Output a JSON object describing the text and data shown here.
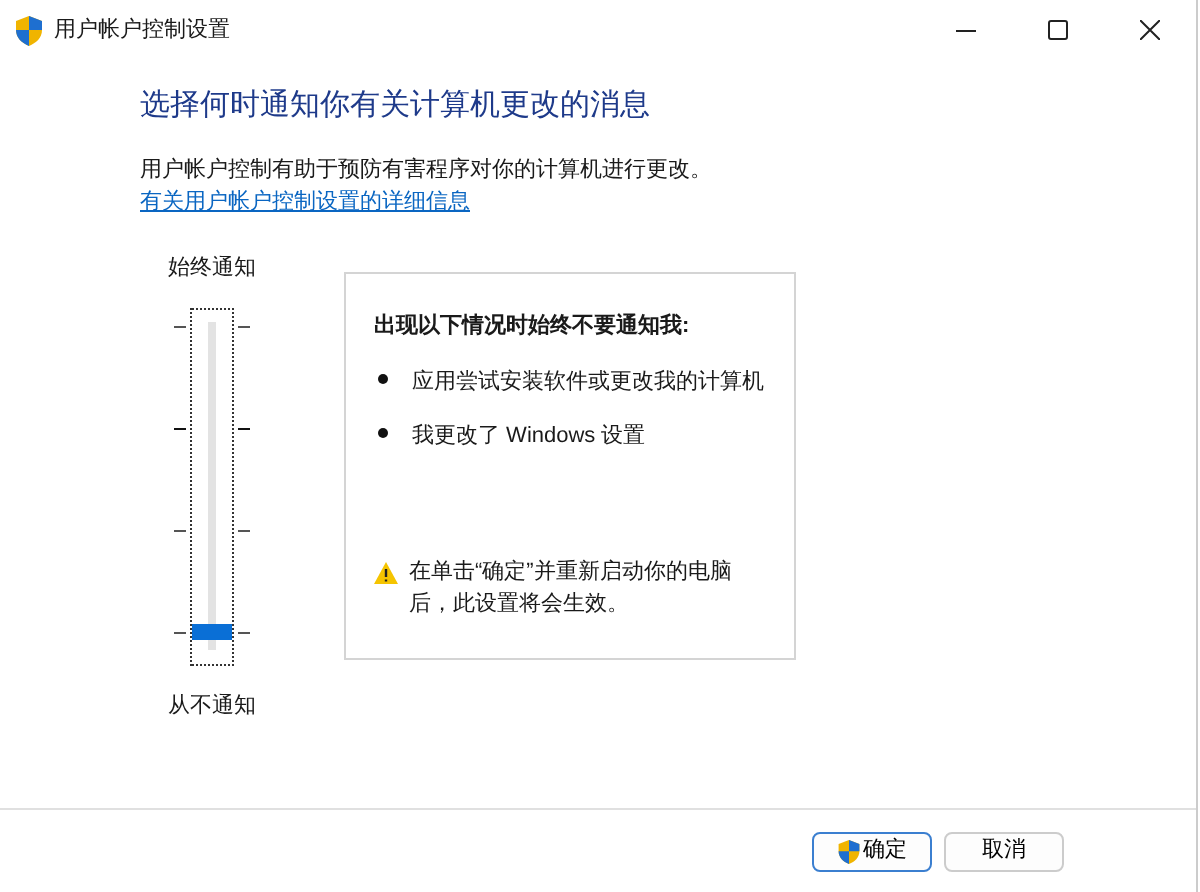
{
  "window": {
    "title": "用户帐户控制设置"
  },
  "heading": "选择何时通知你有关计算机更改的消息",
  "description": "用户帐户控制有助于预防有害程序对你的计算机进行更改。",
  "link": "有关用户帐户控制设置的详细信息",
  "slider": {
    "top_label": "始终通知",
    "bottom_label": "从不通知"
  },
  "info": {
    "title": "出现以下情况时始终不要通知我:",
    "bullets": [
      "应用尝试安装软件或更改我的计算机",
      "我更改了 Windows 设置"
    ],
    "warning": "在单击“确定”并重新启动你的电脑后，此设置将会生效。"
  },
  "buttons": [
    {
      "label": "确定",
      "kind": "shield"
    },
    {
      "label": "取消",
      "kind": "plain"
    }
  ]
}
